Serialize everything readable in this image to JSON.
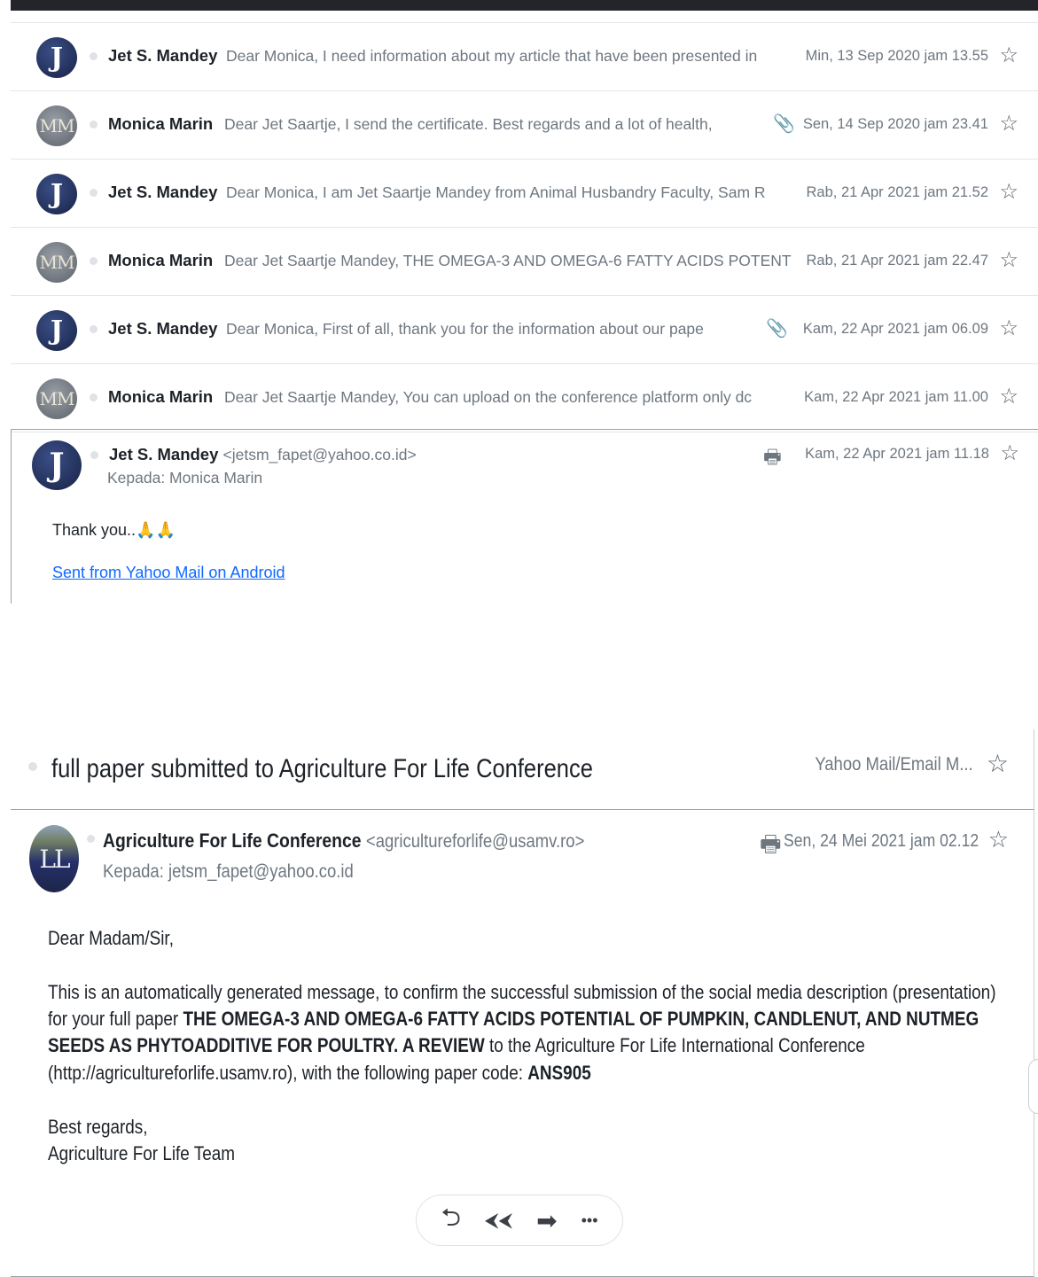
{
  "thread": [
    {
      "avatar": "J",
      "sender": "Jet S. Mandey",
      "snippet": "Dear Monica, I need information about my article that have been presented in",
      "date": "Min, 13 Sep 2020 jam 13.55",
      "attachment": false
    },
    {
      "avatar": "MM",
      "sender": "Monica Marin",
      "snippet": "Dear Jet Saartje, I send the certificate. Best regards and a lot of health,",
      "date": "Sen, 14 Sep 2020 jam 23.41",
      "attachment": true
    },
    {
      "avatar": "J",
      "sender": "Jet S. Mandey",
      "snippet": "Dear Monica, I am Jet Saartje Mandey from Animal Husbandry Faculty, Sam R",
      "date": "Rab, 21 Apr 2021 jam 21.52",
      "attachment": false
    },
    {
      "avatar": "MM",
      "sender": "Monica Marin",
      "snippet": "Dear Jet Saartje Mandey, THE OMEGA-3 AND OMEGA-6 FATTY ACIDS POTENT",
      "date": "Rab, 21 Apr 2021 jam 22.47",
      "attachment": false
    },
    {
      "avatar": "J",
      "sender": "Jet S. Mandey",
      "snippet": "Dear Monica, First of all, thank you for the information about our pape",
      "date": "Kam, 22 Apr 2021 jam 06.09",
      "attachment": true
    },
    {
      "avatar": "MM",
      "sender": "Monica Marin",
      "snippet": "Dear Jet Saartje Mandey, You can upload on the conference platform only dc",
      "date": "Kam, 22 Apr 2021 jam 11.00",
      "attachment": false
    }
  ],
  "open_message": {
    "avatar": "J",
    "sender": "Jet S. Mandey",
    "email": "<jetsm_fapet@yahoo.co.id>",
    "to": "Kepada: Monica Marin",
    "date": "Kam, 22 Apr 2021 jam 11.18",
    "body": "Thank you..",
    "emoji": "🙏🙏",
    "link": "Sent from Yahoo Mail on Android"
  },
  "subject": {
    "text": "full paper submitted to Agriculture For Life Conference",
    "folder": "Yahoo Mail/Email M..."
  },
  "message2": {
    "avatar": "LL",
    "sender": "Agriculture For Life Conference",
    "email": "<agricultureforlife@usamv.ro>",
    "to": "Kepada: jetsm_fapet@yahoo.co.id",
    "date": "Sen, 24 Mei 2021 jam 02.12",
    "greeting": "Dear Madam/Sir,",
    "line1": "This is an automatically generated message, to confirm the successful submission of the social media description (presentation)",
    "line2_a": "for your full paper ",
    "line2_b": "THE OMEGA-3 AND OMEGA-6 FATTY ACIDS POTENTIAL OF PUMPKIN, CANDLENUT, AND NUTMEG",
    "line3_b": "SEEDS AS PHYTOADDITIVE FOR POULTRY. A REVIEW",
    "line3_c": " to the Agriculture For Life International Conference",
    "line4_a": "(http://agricultureforlife.usamv.ro), with the following paper code: ",
    "line4_b": "ANS905",
    "signoff1": "Best regards,",
    "signoff2": "Agriculture For Life Team"
  },
  "icons": {
    "star": "☆",
    "clip": "📎",
    "printer": "🖶",
    "reply": "⮌",
    "reply_all": "⮜⮜",
    "forward": "➡",
    "more": "•••"
  }
}
